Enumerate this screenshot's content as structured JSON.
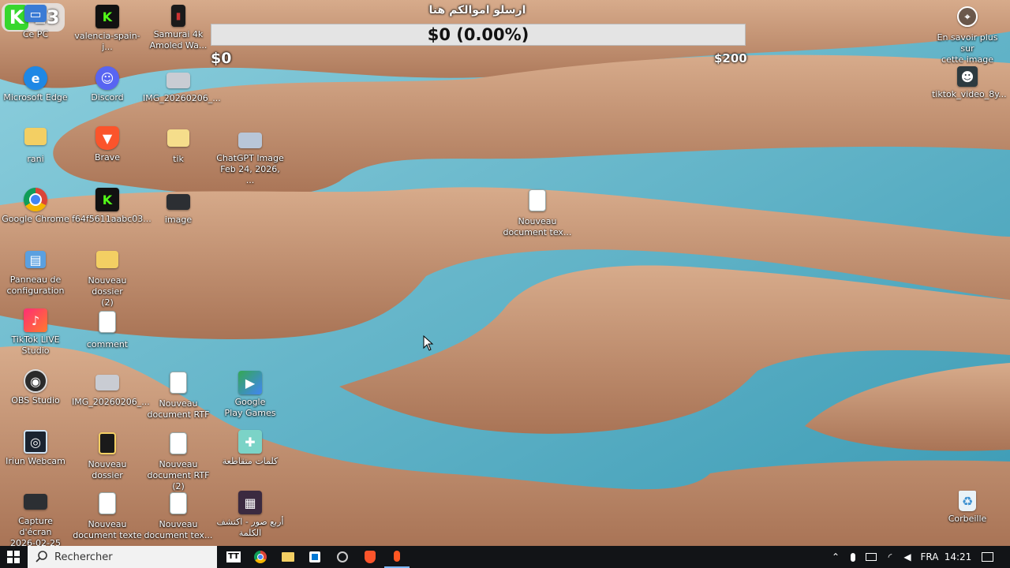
{
  "donation": {
    "title": "ارسلو اموالكم هنا",
    "progress_text": "$0 (0.00%)",
    "progress_percent": 0,
    "goal_min": "$0",
    "goal_max": "$200"
  },
  "badge": {
    "letter": "K",
    "count": "13"
  },
  "desktop": {
    "col1": [
      {
        "label": "Ce PC",
        "name": "this-pc-icon"
      },
      {
        "label": "Microsoft Edge",
        "name": "edge-icon"
      },
      {
        "label": "rani",
        "name": "user-folder-icon"
      },
      {
        "label": "Google Chrome",
        "name": "chrome-icon"
      },
      {
        "label": "Panneau de\nconfiguration",
        "name": "control-panel-icon"
      },
      {
        "label": "TikTok LIVE\nStudio",
        "name": "tiktok-live-icon"
      },
      {
        "label": "OBS Studio",
        "name": "obs-icon"
      },
      {
        "label": "Iriun Webcam",
        "name": "webcam-icon"
      },
      {
        "label": "Capture d'écran\n2026-02-25 17...",
        "name": "screenshot-file-icon"
      }
    ],
    "col2": [
      {
        "label": "valencia-spain-j...",
        "name": "kick-image-icon"
      },
      {
        "label": "Discord",
        "name": "discord-icon"
      },
      {
        "label": "Brave",
        "name": "brave-icon"
      },
      {
        "label": "f64f5611aabc03...",
        "name": "kick-image-icon"
      },
      {
        "label": "Nouveau dossier\n(2)",
        "name": "folder-icon"
      },
      {
        "label": "comment",
        "name": "text-document-icon"
      },
      {
        "label": "IMG_20260206_...",
        "name": "image-file-icon"
      },
      {
        "label": "Nouveau dossier",
        "name": "folder-icon"
      },
      {
        "label": "Nouveau\ndocument texte",
        "name": "text-document-icon"
      }
    ],
    "col3": [
      {
        "label": "Samurai 4k\nAmoled Wa...",
        "name": "wallpaper-image-icon"
      },
      {
        "label": "IMG_20260206_...",
        "name": "image-file-icon"
      },
      {
        "label": "tik",
        "name": "folder-icon"
      },
      {
        "label": "image",
        "name": "image-file-icon"
      },
      {
        "label": "Nouveau\ndocument RTF",
        "name": "rtf-document-icon"
      },
      {
        "label": "Nouveau\ndocument RTF (2)",
        "name": "rtf-document-icon"
      },
      {
        "label": "Nouveau\ndocument tex...",
        "name": "text-document-icon"
      }
    ],
    "col4": [
      {
        "label": "ChatGPT Image\nFeb 24, 2026, ...",
        "name": "image-file-icon"
      },
      {
        "label": "Google\nPlay Games",
        "name": "play-games-icon"
      },
      {
        "label": "كلمات متقاطعة",
        "name": "crossword-icon"
      },
      {
        "label": "أربع صور - اكتشف\nالكلمة",
        "name": "four-pics-icon"
      }
    ],
    "middle_doc": {
      "label": "Nouveau\ndocument tex...",
      "name": "text-document-icon"
    },
    "right": [
      {
        "label": "En savoir plus sur\ncette image",
        "name": "learn-more-icon"
      },
      {
        "label": "tiktok_video_8y...",
        "name": "video-file-icon"
      },
      {
        "label": "Corbeille",
        "name": "recycle-bin-icon"
      }
    ]
  },
  "taskbar": {
    "search_placeholder": "Rechercher",
    "language": "FRA",
    "time": "14:21"
  },
  "colors": {
    "sand": "#c89a7a",
    "water": "#5fb4cb",
    "taskbar": "#121417",
    "progress_bg": "#e4e4e4"
  }
}
